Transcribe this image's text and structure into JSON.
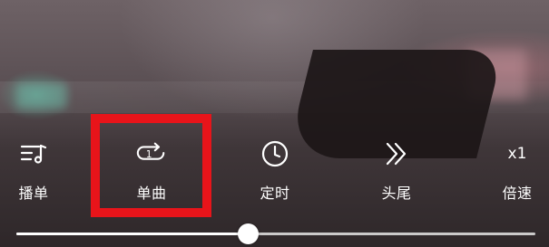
{
  "controls": {
    "playlist": {
      "label": "播单",
      "icon": "playlist-icon"
    },
    "repeat_one": {
      "label": "单曲",
      "icon": "repeat-one-icon",
      "badge": "1"
    },
    "timer": {
      "label": "定时",
      "icon": "clock-icon"
    },
    "skip_intro_outro": {
      "label": "头尾",
      "icon": "double-chevron-right-icon"
    },
    "speed": {
      "label": "倍速",
      "value": "x1"
    }
  },
  "progress": {
    "fraction": 0.446
  },
  "colors": {
    "highlight": "#e8141a",
    "text": "#ffffff"
  }
}
